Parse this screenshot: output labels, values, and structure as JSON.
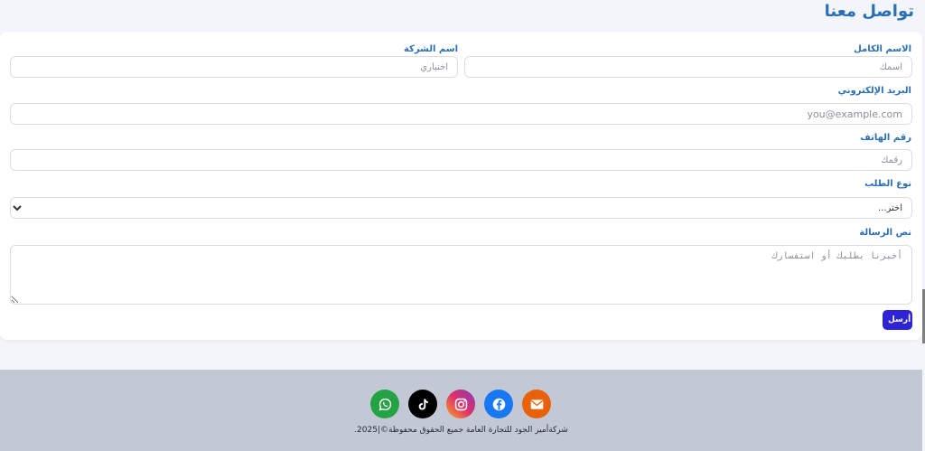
{
  "page": {
    "title": "تواصل معنا"
  },
  "form": {
    "full_name": {
      "label": "الاسم الكامل",
      "placeholder": "اسمك"
    },
    "company_name": {
      "label": "اسم الشركة",
      "placeholder": "اختياري"
    },
    "email": {
      "label": "البريد الإلكتروني",
      "placeholder": "you@example.com"
    },
    "phone": {
      "label": "رقم الهاتف",
      "placeholder": "رقمك"
    },
    "request_type": {
      "label": "نوع الطلب",
      "selected": "اختر..."
    },
    "message": {
      "label": "نص الرسالة",
      "placeholder": "أخبرنا بطلبك أو استفسارك"
    },
    "submit_label": "أرسل"
  },
  "footer": {
    "social": [
      {
        "name": "email-icon",
        "color": "#e8620c"
      },
      {
        "name": "facebook-icon",
        "color": "#1877f2"
      },
      {
        "name": "instagram-icon",
        "color": "#c13584"
      },
      {
        "name": "tiktok-icon",
        "color": "#000000"
      },
      {
        "name": "whatsapp-icon",
        "color": "#25a244"
      }
    ],
    "copyright": "شركةأمير الجود للتجارة العامة جميع الحقوق محفوظة©|2025."
  }
}
